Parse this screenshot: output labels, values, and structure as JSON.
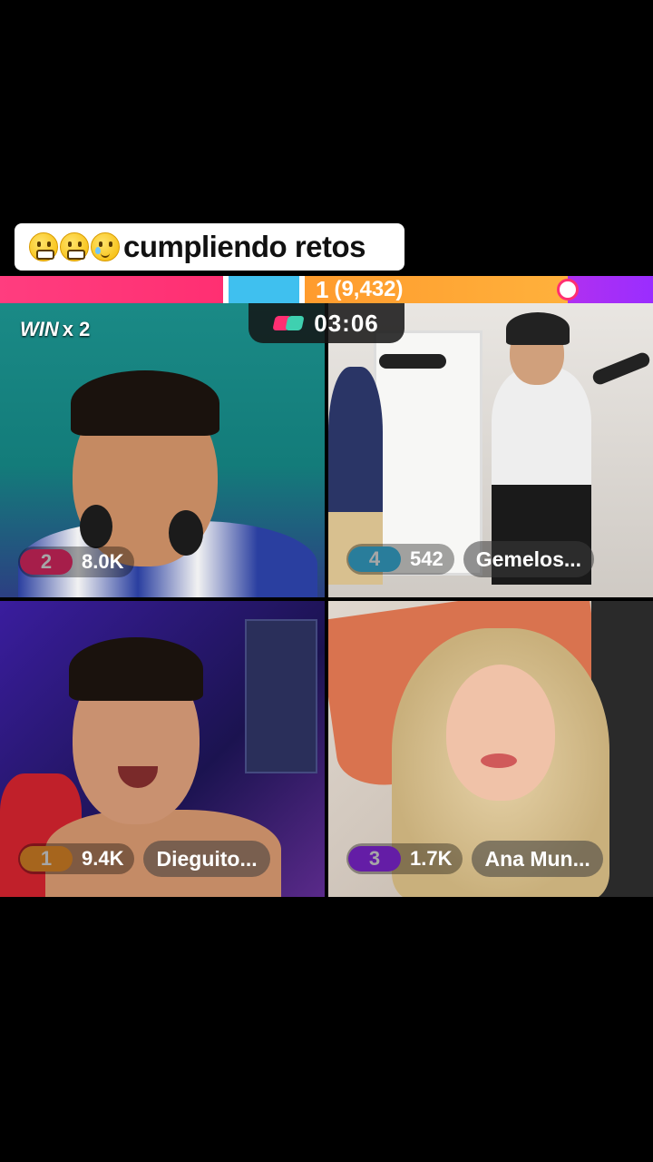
{
  "caption": {
    "emojis": [
      "grimacing-face-icon",
      "grimacing-face-icon",
      "face-holding-back-tears-icon"
    ],
    "text": "cumpliendo retos"
  },
  "battle_bar": {
    "leader_rank": "1",
    "leader_score": "(9,432)",
    "colors": {
      "rank1": "#ff9b2d",
      "rank2": "#ff2f72",
      "rank3": "#9a2dff",
      "rank4": "#3fc0ef"
    }
  },
  "timer": {
    "icon": "battle-vs-icon",
    "text": "03:06"
  },
  "win_badge": {
    "label": "WIN",
    "multiplier": "x 2"
  },
  "participants": [
    {
      "rank": "2",
      "score": "8.0K",
      "name": ""
    },
    {
      "rank": "4",
      "score": "542",
      "name": "Gemelos..."
    },
    {
      "rank": "1",
      "score": "9.4K",
      "name": "Dieguito..."
    },
    {
      "rank": "3",
      "score": "1.7K",
      "name": "Ana Mun..."
    }
  ]
}
